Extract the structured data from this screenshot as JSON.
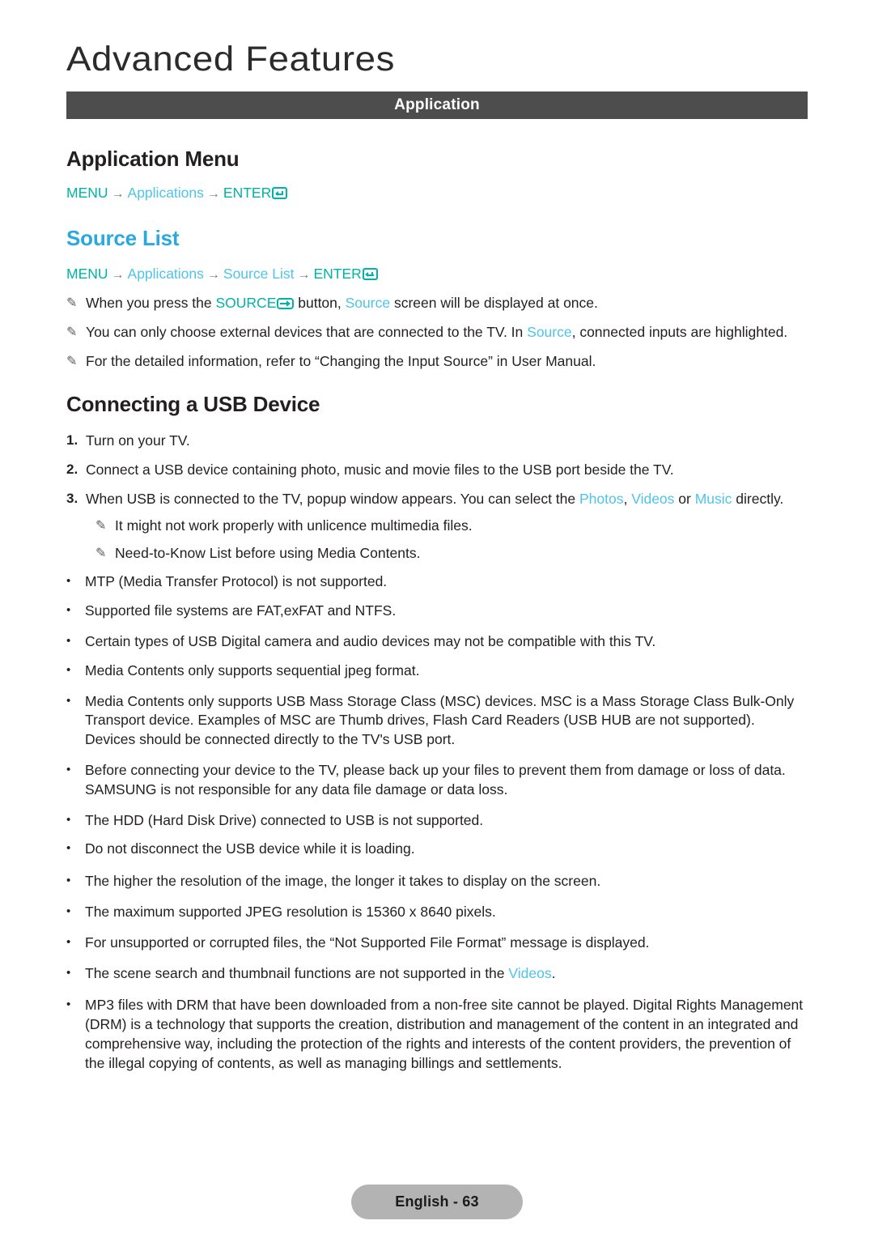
{
  "page": {
    "chapter_title": "Advanced Features",
    "section_banner": "Application",
    "footer_label": "English - 63"
  },
  "colors": {
    "banner_bg": "#4d4d4d",
    "heading_blue": "#29a9e0",
    "menu_key_teal": "#00b3a6",
    "menu_item_blue": "#4fc3e8",
    "footer_pill_bg": "#b3b3b3",
    "body_text": "#231f20"
  },
  "icons": {
    "note": "pencil-icon",
    "enter": "enter-key-icon",
    "source": "source-button-icon",
    "arrow": "right-arrow-icon",
    "bullet": "bullet-dot-icon"
  },
  "application_menu": {
    "heading": "Application Menu",
    "path": {
      "menu": "MENU",
      "arrow": "→",
      "applications": "Applications",
      "enter": "ENTER"
    }
  },
  "source_list": {
    "heading": "Source List",
    "path": {
      "menu": "MENU",
      "arrow": "→",
      "applications": "Applications",
      "source_list": "Source List",
      "enter": "ENTER"
    },
    "notes": [
      {
        "pre": "When you press the ",
        "key": "SOURCE",
        "mid": " button, ",
        "link": "Source",
        "post": " screen will be displayed at once."
      },
      {
        "pre": "You can only choose external devices that are connected to the TV. In ",
        "link": "Source",
        "post": ", connected inputs are highlighted."
      },
      {
        "pre": "For the detailed information, refer to “Changing the Input Source” in User Manual."
      }
    ]
  },
  "connecting_usb": {
    "heading": "Connecting a USB Device",
    "steps": [
      {
        "num": "1.",
        "text": "Turn on your TV."
      },
      {
        "num": "2.",
        "text": "Connect a USB device containing photo, music and movie files to the USB port beside the TV."
      },
      {
        "num": "3.",
        "pre": "When USB is connected to the TV, popup window appears. You can select the ",
        "link1": "Photos",
        "sep1": ", ",
        "link2": "Videos",
        "sep2": " or ",
        "link3": "Music",
        "post": " directly."
      }
    ],
    "sub_notes": [
      "It might not work properly with unlicence multimedia files.",
      "Need-to-Know List before using Media Contents."
    ],
    "bullets": [
      "MTP (Media Transfer Protocol) is not supported.",
      "Supported file systems are FAT,exFAT and NTFS.",
      "Certain types of USB Digital camera and audio devices may not be compatible with this TV.",
      "Media Contents only supports sequential jpeg format.",
      "Media Contents only supports USB Mass Storage Class (MSC) devices. MSC is a Mass Storage Class Bulk-Only Transport device. Examples of MSC are Thumb drives, Flash Card Readers (USB HUB are not supported). Devices should be connected directly to the TV's USB port.",
      "Before connecting your device to the TV, please back up your files to prevent them from damage or loss of data. SAMSUNG is not responsible for any data file damage or data loss.",
      "The HDD (Hard Disk Drive) connected to USB is not supported.",
      "Do not disconnect the USB device while it is loading.",
      "The higher the resolution of the image, the longer it takes to display on the screen.",
      "The maximum supported JPEG resolution is 15360 x 8640 pixels."
    ],
    "bullet_unsupported": "For unsupported or corrupted files, the “Not Supported File Format” message is displayed.",
    "bullet_scene_search": {
      "pre": "The scene search and thumbnail functions are not supported in the ",
      "link": "Videos",
      "post": "."
    },
    "bullet_drm": "MP3 files with DRM that have been downloaded from a non-free site cannot be played. Digital Rights Management (DRM) is a technology that supports the creation, distribution and management of the content in an integrated and comprehensive way, including the protection of the rights and interests of the content providers, the prevention of the illegal copying of contents, as well as managing billings and settlements."
  }
}
